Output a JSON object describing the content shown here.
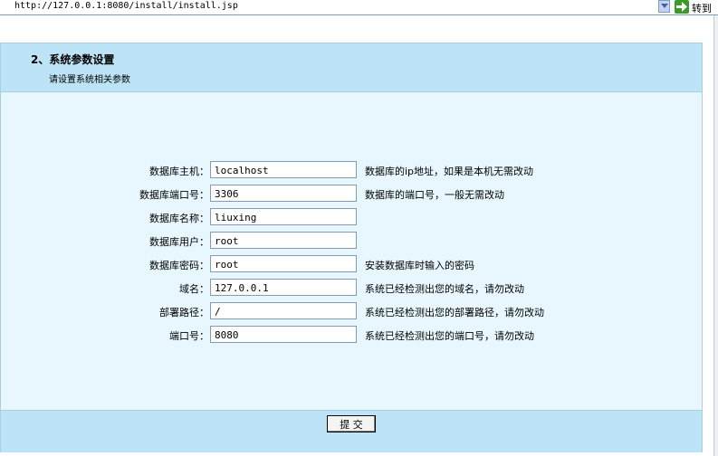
{
  "browser": {
    "address": "http://127.0.0.1:8080/install/install.jsp",
    "go_label": "转到"
  },
  "header": {
    "title": "2、系统参数设置",
    "subtitle": "请设置系统相关参数"
  },
  "form": {
    "rows": [
      {
        "label": "数据库主机：",
        "value": "localhost",
        "hint": "数据库的ip地址，如果是本机无需改动"
      },
      {
        "label": "数据库端口号：",
        "value": "3306",
        "hint": "数据库的端口号，一般无需改动"
      },
      {
        "label": "数据库名称：",
        "value": "liuxing",
        "hint": ""
      },
      {
        "label": "数据库用户：",
        "value": "root",
        "hint": ""
      },
      {
        "label": "数据库密码：",
        "value": "root",
        "hint": "安装数据库时输入的密码"
      },
      {
        "label": "域名：",
        "value": "127.0.0.1",
        "hint": "系统已经检测出您的域名，请勿改动"
      },
      {
        "label": "部署路径：",
        "value": "/",
        "hint": "系统已经检测出您的部署路径，请勿改动"
      },
      {
        "label": "端口号：",
        "value": "8080",
        "hint": "系统已经检测出您的端口号，请勿改动"
      }
    ]
  },
  "footer": {
    "submit_label": "提 交"
  }
}
